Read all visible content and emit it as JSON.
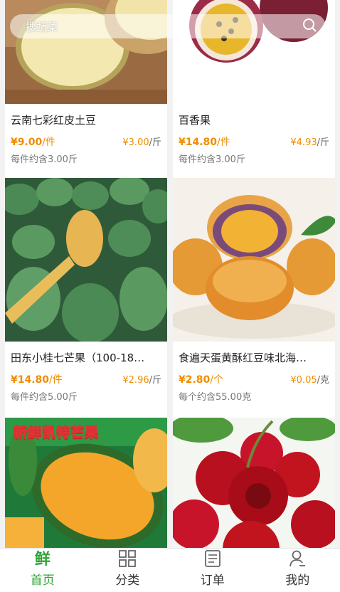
{
  "search": {
    "placeholder": "搜蔬菜"
  },
  "products": [
    {
      "name": "云南七彩红皮土豆",
      "price": "¥9.00",
      "price_unit": "/件",
      "unit_price": "¥3.00",
      "unit_price_unit": "/斤",
      "weight": "每件约含3.00斤"
    },
    {
      "name": "百香果",
      "price": "¥14.80",
      "price_unit": "/件",
      "unit_price": "¥4.93",
      "unit_price_unit": "/斤",
      "weight": "每件约含3.00斤"
    },
    {
      "name": "田东小桂七芒果（100-18…",
      "price": "¥14.80",
      "price_unit": "/件",
      "unit_price": "¥2.96",
      "unit_price_unit": "/斤",
      "weight": "每件约含5.00斤"
    },
    {
      "name": "食遍天蛋黄酥红豆味北海…",
      "price": "¥2.80",
      "price_unit": "/个",
      "unit_price": "¥0.05",
      "unit_price_unit": "/克",
      "weight": "每个约含55.00克"
    },
    {
      "promo_text": "新鲜凯特芒果"
    },
    {}
  ],
  "tabbar": {
    "items": [
      {
        "icon": "xian-logo-icon",
        "icon_text": "鲜",
        "label": "首页",
        "active": true
      },
      {
        "icon": "category-grid-icon",
        "label": "分类"
      },
      {
        "icon": "order-list-icon",
        "label": "订单"
      },
      {
        "icon": "user-profile-icon",
        "label": "我的"
      }
    ]
  },
  "colors": {
    "accent_green": "#2fa335",
    "price_orange": "#f08c00"
  }
}
